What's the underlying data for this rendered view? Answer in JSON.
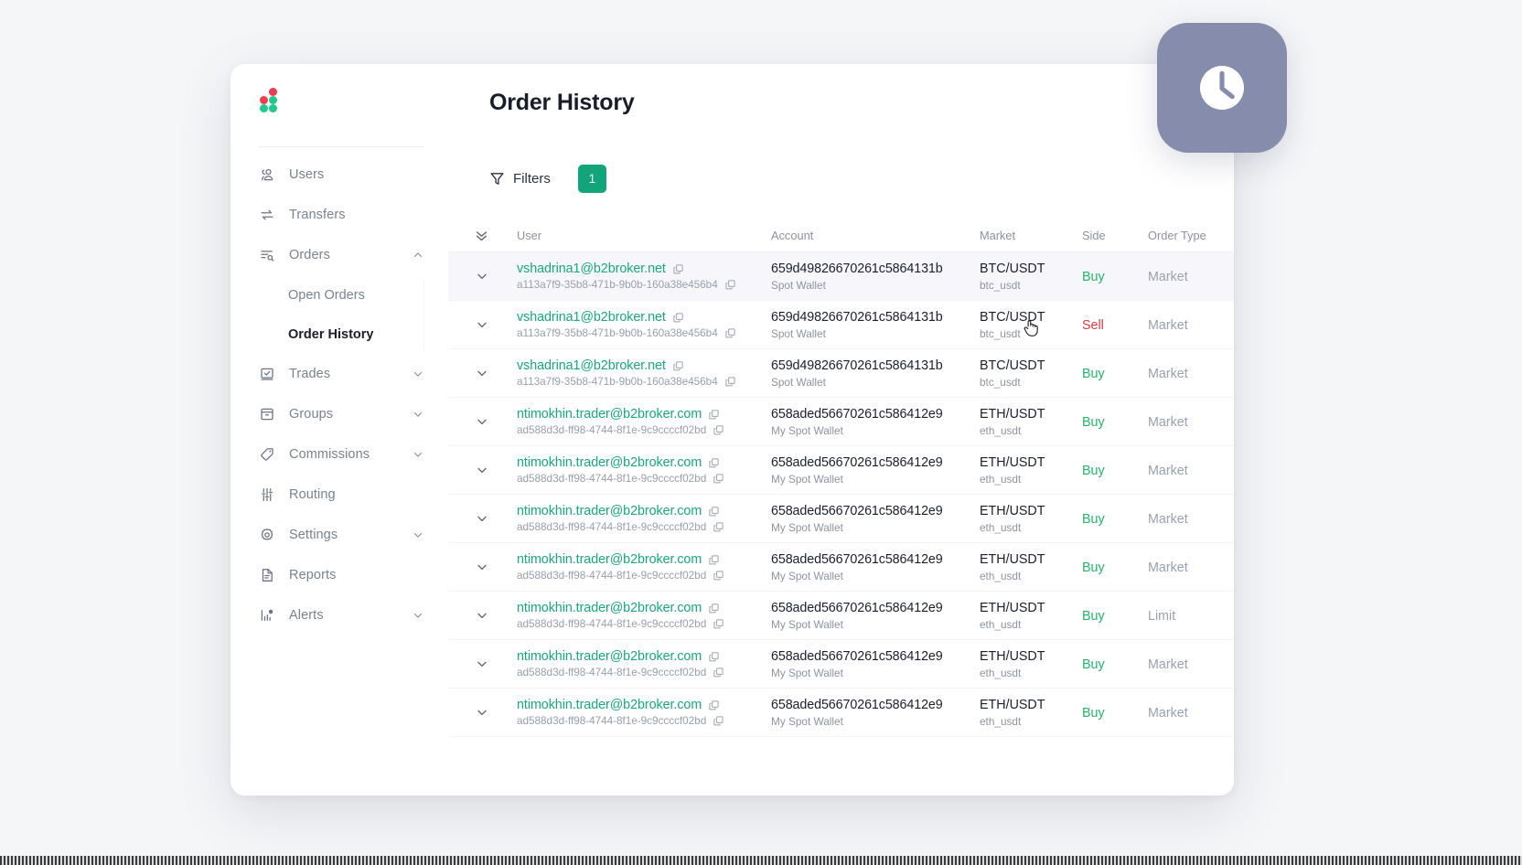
{
  "app": {
    "logo_name": "b2broker-logo",
    "page_title": "Order History",
    "accent_green": "#11a579",
    "link_green": "#16a97a",
    "buy_green": "#21b66c",
    "sell_red": "#e0393f",
    "badge_purple": "#868cab"
  },
  "sidebar": {
    "items": [
      {
        "label": "Users",
        "icon": "users-icon",
        "expandable": false,
        "expanded": false
      },
      {
        "label": "Transfers",
        "icon": "transfers-icon",
        "expandable": false,
        "expanded": false
      },
      {
        "label": "Orders",
        "icon": "orders-icon",
        "expandable": true,
        "expanded": true
      },
      {
        "label": "Trades",
        "icon": "trades-icon",
        "expandable": true,
        "expanded": false
      },
      {
        "label": "Groups",
        "icon": "groups-icon",
        "expandable": true,
        "expanded": false
      },
      {
        "label": "Commissions",
        "icon": "tag-icon",
        "expandable": true,
        "expanded": false
      },
      {
        "label": "Routing",
        "icon": "sliders-icon",
        "expandable": false,
        "expanded": false
      },
      {
        "label": "Settings",
        "icon": "gear-icon",
        "expandable": true,
        "expanded": false
      },
      {
        "label": "Reports",
        "icon": "document-icon",
        "expandable": false,
        "expanded": false
      },
      {
        "label": "Alerts",
        "icon": "alerts-bar-icon",
        "expandable": true,
        "expanded": false
      }
    ],
    "orders_submenu": [
      {
        "label": "Open Orders",
        "active": false
      },
      {
        "label": "Order History",
        "active": true
      }
    ]
  },
  "toolbar": {
    "filters_label": "Filters",
    "filters_icon": "funnel-icon",
    "filters_count": "1"
  },
  "table": {
    "expand_all_icon": "double-chevron-down-icon",
    "columns": [
      {
        "key": "user",
        "label": "User"
      },
      {
        "key": "acct",
        "label": "Account"
      },
      {
        "key": "mkt",
        "label": "Market"
      },
      {
        "key": "side",
        "label": "Side"
      },
      {
        "key": "type",
        "label": "Order Type"
      }
    ],
    "rows": [
      {
        "email": "vshadrina1@b2broker.net",
        "uuid": "a113a7f9-35b8-471b-9b0b-160a38e456b4",
        "account_id": "659d49826670261c5864131b",
        "account_name": "Spot Wallet",
        "market": "BTC/USDT",
        "symbol": "btc_usdt",
        "side": "Buy",
        "order_type": "Market",
        "highlighted": true
      },
      {
        "email": "vshadrina1@b2broker.net",
        "uuid": "a113a7f9-35b8-471b-9b0b-160a38e456b4",
        "account_id": "659d49826670261c5864131b",
        "account_name": "Spot Wallet",
        "market": "BTC/USDT",
        "symbol": "btc_usdt",
        "side": "Sell",
        "order_type": "Market",
        "highlighted": false
      },
      {
        "email": "vshadrina1@b2broker.net",
        "uuid": "a113a7f9-35b8-471b-9b0b-160a38e456b4",
        "account_id": "659d49826670261c5864131b",
        "account_name": "Spot Wallet",
        "market": "BTC/USDT",
        "symbol": "btc_usdt",
        "side": "Buy",
        "order_type": "Market",
        "highlighted": false
      },
      {
        "email": "ntimokhin.trader@b2broker.com",
        "uuid": "ad588d3d-ff98-4744-8f1e-9c9ccccf02bd",
        "account_id": "658aded56670261c586412e9",
        "account_name": "My Spot Wallet",
        "market": "ETH/USDT",
        "symbol": "eth_usdt",
        "side": "Buy",
        "order_type": "Market",
        "highlighted": false
      },
      {
        "email": "ntimokhin.trader@b2broker.com",
        "uuid": "ad588d3d-ff98-4744-8f1e-9c9ccccf02bd",
        "account_id": "658aded56670261c586412e9",
        "account_name": "My Spot Wallet",
        "market": "ETH/USDT",
        "symbol": "eth_usdt",
        "side": "Buy",
        "order_type": "Market",
        "highlighted": false
      },
      {
        "email": "ntimokhin.trader@b2broker.com",
        "uuid": "ad588d3d-ff98-4744-8f1e-9c9ccccf02bd",
        "account_id": "658aded56670261c586412e9",
        "account_name": "My Spot Wallet",
        "market": "ETH/USDT",
        "symbol": "eth_usdt",
        "side": "Buy",
        "order_type": "Market",
        "highlighted": false
      },
      {
        "email": "ntimokhin.trader@b2broker.com",
        "uuid": "ad588d3d-ff98-4744-8f1e-9c9ccccf02bd",
        "account_id": "658aded56670261c586412e9",
        "account_name": "My Spot Wallet",
        "market": "ETH/USDT",
        "symbol": "eth_usdt",
        "side": "Buy",
        "order_type": "Market",
        "highlighted": false
      },
      {
        "email": "ntimokhin.trader@b2broker.com",
        "uuid": "ad588d3d-ff98-4744-8f1e-9c9ccccf02bd",
        "account_id": "658aded56670261c586412e9",
        "account_name": "My Spot Wallet",
        "market": "ETH/USDT",
        "symbol": "eth_usdt",
        "side": "Buy",
        "order_type": "Limit",
        "highlighted": false
      },
      {
        "email": "ntimokhin.trader@b2broker.com",
        "uuid": "ad588d3d-ff98-4744-8f1e-9c9ccccf02bd",
        "account_id": "658aded56670261c586412e9",
        "account_name": "My Spot Wallet",
        "market": "ETH/USDT",
        "symbol": "eth_usdt",
        "side": "Buy",
        "order_type": "Market",
        "highlighted": false
      },
      {
        "email": "ntimokhin.trader@b2broker.com",
        "uuid": "ad588d3d-ff98-4744-8f1e-9c9ccccf02bd",
        "account_id": "658aded56670261c586412e9",
        "account_name": "My Spot Wallet",
        "market": "ETH/USDT",
        "symbol": "eth_usdt",
        "side": "Buy",
        "order_type": "Market",
        "highlighted": false
      }
    ]
  },
  "overlay": {
    "clock_badge_icon": "clock-icon",
    "cursor_icon": "pointer-hand-cursor"
  }
}
